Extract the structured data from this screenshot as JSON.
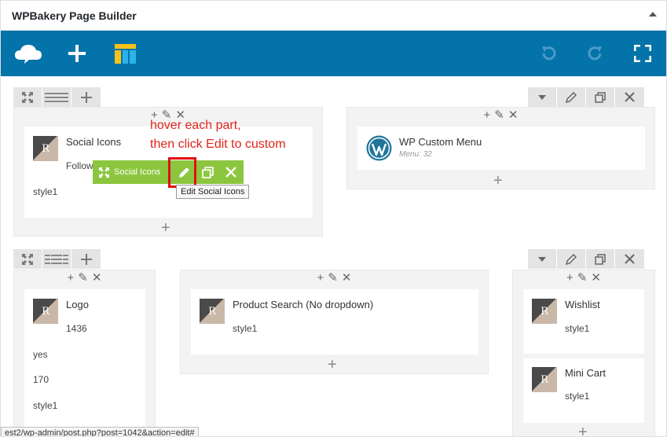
{
  "panel": {
    "title": "WPBakery Page Builder"
  },
  "toolbar": {
    "logo_icon": "cloud-logo-icon",
    "add_icon": "plus-icon",
    "templates_icon": "templates-icon",
    "undo_icon": "undo-icon",
    "redo_icon": "redo-icon",
    "fullscreen_icon": "fullscreen-icon",
    "bg_color": "#0473aa"
  },
  "row1": {
    "left_column": {
      "element": {
        "name": "Social Icons",
        "param1": "Follow",
        "param2": "style1"
      }
    },
    "right_column": {
      "element": {
        "name": "WP Custom Menu",
        "sub": "Menu: 32"
      }
    }
  },
  "hover_controls": {
    "label": "Social Icons",
    "color": "#8cc63f"
  },
  "tooltip": {
    "text": "Edit Social Icons"
  },
  "annotation": {
    "line1": "hover each part,",
    "line2": "then click Edit to custom",
    "color": "#e0241b"
  },
  "row2": {
    "col1": {
      "element": {
        "name": "Logo",
        "values": [
          "1436",
          "yes",
          "170",
          "style1"
        ]
      }
    },
    "col2": {
      "element": {
        "name": "Product Search (No dropdown)",
        "param": "style1"
      }
    },
    "col3": {
      "elements": [
        {
          "name": "Wishlist",
          "param": "style1"
        },
        {
          "name": "Mini Cart",
          "param": "style1"
        }
      ]
    }
  },
  "status_url": "est2/wp-admin/post.php?post=1042&action=edit#"
}
